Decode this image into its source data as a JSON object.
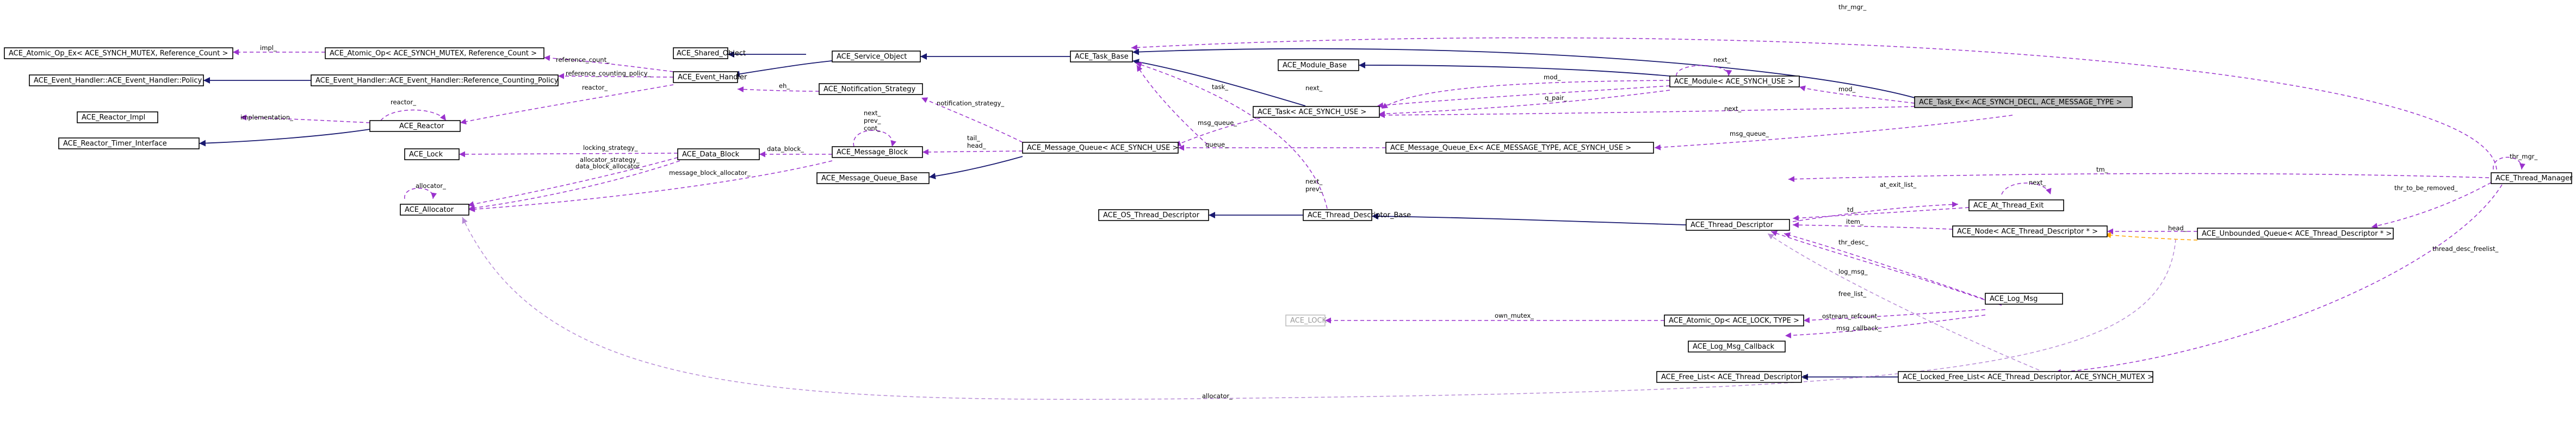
{
  "nodes": {
    "atomic_op_ex_refcount": "ACE_Atomic_Op_Ex< ACE_SYNCH_MUTEX, Reference_Count >",
    "atomic_op_refcount": "ACE_Atomic_Op< ACE_SYNCH_MUTEX, Reference_Count >",
    "event_handler_policy": "ACE_Event_Handler::ACE_Event_Handler::Policy",
    "event_handler_rc_policy": "ACE_Event_Handler::ACE_Event_Handler::Reference_Counting_Policy",
    "reactor_impl": "ACE_Reactor_Impl",
    "reactor": "ACE_Reactor",
    "reactor_timer_interface": "ACE_Reactor_Timer_Interface",
    "lock": "ACE_Lock",
    "allocator": "ACE_Allocator",
    "shared_object": "ACE_Shared_Object",
    "service_object": "ACE_Service_Object",
    "event_handler": "ACE_Event_Handler",
    "notification_strategy": "ACE_Notification_Strategy",
    "data_block": "ACE_Data_Block",
    "message_block": "ACE_Message_Block",
    "message_queue_base": "ACE_Message_Queue_Base",
    "message_queue": "ACE_Message_Queue< ACE_SYNCH_USE >",
    "task_base": "ACE_Task_Base",
    "module_base": "ACE_Module_Base",
    "task": "ACE_Task< ACE_SYNCH_USE >",
    "module": "ACE_Module< ACE_SYNCH_USE >",
    "task_ex": "ACE_Task_Ex< ACE_SYNCH_DECL, ACE_MESSAGE_TYPE >",
    "message_queue_ex": "ACE_Message_Queue_Ex< ACE_MESSAGE_TYPE, ACE_SYNCH_USE >",
    "os_thread_descriptor": "ACE_OS_Thread_Descriptor",
    "thread_descriptor_base": "ACE_Thread_Descriptor_Base",
    "thread_descriptor": "ACE_Thread_Descriptor",
    "at_thread_exit": "ACE_At_Thread_Exit",
    "node_thread_descriptor": "ACE_Node< ACE_Thread_Descriptor * >",
    "ace_lock_upper": "ACE_LOCK",
    "atomic_op_lock_type": "ACE_Atomic_Op< ACE_LOCK, TYPE >",
    "log_msg": "ACE_Log_Msg",
    "log_msg_callback": "ACE_Log_Msg_Callback",
    "free_list": "ACE_Free_List< ACE_Thread_Descriptor >",
    "locked_free_list": "ACE_Locked_Free_List< ACE_Thread_Descriptor, ACE_SYNCH_MUTEX >",
    "unbounded_queue": "ACE_Unbounded_Queue< ACE_Thread_Descriptor * >",
    "thread_manager": "ACE_Thread_Manager"
  },
  "labels": {
    "impl": "impl_",
    "reference_count": "reference_count_",
    "reference_counting_policy": "reference_counting_policy_",
    "reactor_a": "reactor_",
    "reactor_b": "reactor_",
    "implementation": "implementation_",
    "eh": "eh_",
    "notification_strategy": "notification_strategy_",
    "locking_strategy": "locking_strategy_",
    "allocator_strategy": "allocator_strategy_",
    "data_block_allocator": "data_block_allocator_",
    "message_block_allocator": "message_block_allocator_",
    "allocator_self": "allocator_",
    "data_block": "data_block_",
    "next_prev_cont_1": "next_",
    "next_prev_cont_2": "prev_",
    "next_prev_cont_3": "cont_",
    "tail_head_1": "tail_",
    "tail_head_2": "head_",
    "msg_queue_a": "msg_queue_",
    "msg_queue_b": "msg_queue_",
    "queue": "queue_",
    "task": "task_",
    "thr_mgr_a": "thr_mgr_",
    "thr_mgr_b": "thr_mgr_",
    "thr_mgr_self": "thr_mgr_",
    "next_module_self": "next_",
    "mod_a": "mod_",
    "mod_b": "mod_",
    "next_a": "next_",
    "next_b": "next_",
    "q_pair": "q_pair_",
    "next_prev_tdb_1": "next_",
    "next_prev_tdb_2": "prev_",
    "tm": "tm_",
    "at_exit_list": "at_exit_list_",
    "next_at_exit": "next_",
    "td": "td_",
    "item": "item_",
    "head": "head_",
    "thr_desc": "thr_desc_",
    "log_msg": "log_msg_",
    "free_list": "free_list_",
    "own_mutex": "own_mutex_",
    "ostream_refcount": "ostream_refcount_",
    "msg_callback": "msg_callback_",
    "thr_to_be_removed": "thr_to_be_removed_",
    "thread_desc_freelist": "thread_desc_freelist_",
    "allocator_bottom": "allocator_"
  }
}
